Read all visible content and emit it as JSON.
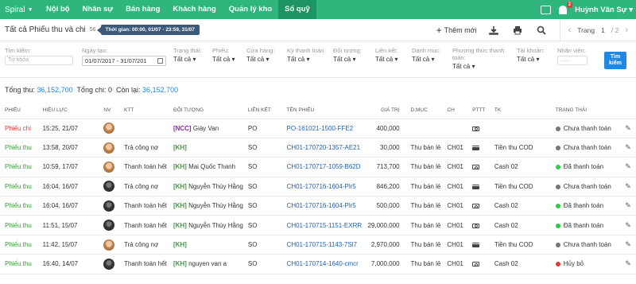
{
  "nav": {
    "brand": "Spiral",
    "items": [
      "Nội bộ",
      "Nhân sự",
      "Bán hàng",
      "Khách hàng",
      "Quản lý kho",
      "Sổ quỹ"
    ],
    "user": "Huỳnh Văn Sự",
    "notification_count": "2"
  },
  "header": {
    "title": "Tất cả Phiếu thu và chi",
    "count": "56",
    "time_chip": "Thời gian: 00:00, 01/07 - 23:59, 31/07",
    "add_label": "Thêm mới",
    "page_label": "Trang",
    "page_current": "1",
    "page_total": "/ 2"
  },
  "filters": {
    "search_label": "Tìm kiếm:",
    "search_placeholder": "Từ khóa",
    "date_label": "Ngày tạo:",
    "date_value": "01/07/2017 - 31/07/201",
    "status_label": "Trạng thái:",
    "status_value": "Tất cả",
    "type_label": "Phiếu:",
    "type_value": "Tất cả",
    "store_label": "Cửa hàng:",
    "store_value": "Tất cả",
    "period_label": "Kỳ thanh toán:",
    "period_value": "Tất cả",
    "object_label": "Đối tượng:",
    "object_value": "Tất cả",
    "link_label": "Liên kết:",
    "link_value": "Tất cả",
    "category_label": "Danh mục:",
    "category_value": "Tất cả",
    "method_label": "Phương thức thanh toán:",
    "method_value": "Tất cả",
    "account_label": "Tài khoản:",
    "account_value": "Tất cả",
    "staff_label": "Nhân viên:",
    "staff_value": "......",
    "search_button": "Tìm kiếm"
  },
  "totals": {
    "income_label": "Tổng thu:",
    "income": "36,152,700",
    "expense_label": "Tổng chi:",
    "expense": "0",
    "remain_label": "Còn lại:",
    "remain": "36,152,700"
  },
  "columns": [
    "PHIẾU",
    "HIỆU LỰC",
    "NV",
    "KTT",
    "ĐỐI TƯỢNG",
    "LIÊN KẾT",
    "TÊN PHIẾU",
    "GIÁ TRỊ",
    "D.MỤC",
    "CH",
    "PTTT",
    "TK",
    "TRẠNG THÁI"
  ],
  "rows": [
    {
      "type": "Phiếu chi",
      "kind": "chi",
      "date": "15:25, 21/07",
      "avatar": "a",
      "ktt": "",
      "tag": "[NCC]",
      "tagkind": "ncc",
      "obj": "Giày Van",
      "link": "PO",
      "name": "PO-161021-1500-FFE2",
      "value": "400,000",
      "cat": "",
      "ch": "",
      "pttt": "cash",
      "tk": "",
      "status": "Chưa thanh toán",
      "status_color": "#757575"
    },
    {
      "type": "Phiếu thu",
      "kind": "thu",
      "date": "13:58, 20/07",
      "avatar": "a",
      "ktt": "Trả công nợ",
      "tag": "[KH]",
      "tagkind": "kh",
      "obj": "",
      "link": "SO",
      "name": "CH01-170720-1357-AE21",
      "value": "30,000",
      "cat": "Thu bán lẻ",
      "ch": "CH01",
      "pttt": "card",
      "tk": "Tiền thu COD",
      "status": "Chưa thanh toán",
      "status_color": "#757575"
    },
    {
      "type": "Phiếu thu",
      "kind": "thu",
      "date": "10:59, 17/07",
      "avatar": "a",
      "ktt": "Thanh toán hết",
      "tag": "[KH]",
      "tagkind": "kh",
      "obj": "Mai Quốc Thanh",
      "link": "SO",
      "name": "CH01-170717-1059-B62D",
      "value": "713,700",
      "cat": "Thu bán lẻ",
      "ch": "CH01",
      "pttt": "cash",
      "tk": "Cash 02",
      "status": "Đã thanh toán",
      "status_color": "#2ecc40"
    },
    {
      "type": "Phiếu thu",
      "kind": "thu",
      "date": "16:04, 16/07",
      "avatar": "b",
      "ktt": "Trả công nợ",
      "tag": "[KH]",
      "tagkind": "kh",
      "obj": "Nguyễn Thùy Hằng",
      "link": "SO",
      "name": "CH01-170716-1604-Plr5",
      "value": "846,200",
      "cat": "Thu bán lẻ",
      "ch": "CH01",
      "pttt": "card",
      "tk": "Tiền thu COD",
      "status": "Chưa thanh toán",
      "status_color": "#757575"
    },
    {
      "type": "Phiếu thu",
      "kind": "thu",
      "date": "16:04, 16/07",
      "avatar": "b",
      "ktt": "Thanh toán hết",
      "tag": "[KH]",
      "tagkind": "kh",
      "obj": "Nguyễn Thùy Hằng",
      "link": "SO",
      "name": "CH01-170716-1604-Plr5",
      "value": "500,000",
      "cat": "Thu bán lẻ",
      "ch": "CH01",
      "pttt": "cash",
      "tk": "Cash 02",
      "status": "Đã thanh toán",
      "status_color": "#2ecc40"
    },
    {
      "type": "Phiếu thu",
      "kind": "thu",
      "date": "11:51, 15/07",
      "avatar": "b",
      "ktt": "Thanh toán hết",
      "tag": "[KH]",
      "tagkind": "kh",
      "obj": "Nguyễn Thùy Hằng",
      "link": "SO",
      "name": "CH01-170715-1151-EXRR",
      "value": "29,000,000",
      "cat": "Thu bán lẻ",
      "ch": "CH01",
      "pttt": "cash",
      "tk": "Cash 02",
      "status": "Đã thanh toán",
      "status_color": "#2ecc40"
    },
    {
      "type": "Phiếu thu",
      "kind": "thu",
      "date": "11:42, 15/07",
      "avatar": "a",
      "ktt": "Trả công nợ",
      "tag": "[KH]",
      "tagkind": "kh",
      "obj": "",
      "link": "SO",
      "name": "CH01-170715-1143-7Sl7",
      "value": "2,970,000",
      "cat": "Thu bán lẻ",
      "ch": "CH01",
      "pttt": "card",
      "tk": "Tiền thu COD",
      "status": "Chưa thanh toán",
      "status_color": "#757575"
    },
    {
      "type": "Phiếu thu",
      "kind": "thu",
      "date": "16:40, 14/07",
      "avatar": "b",
      "ktt": "Thanh toán hết",
      "tag": "[KH]",
      "tagkind": "kh",
      "obj": "nguyen van a",
      "link": "SO",
      "name": "CH01-170714-1640-cmcr",
      "value": "7,000,000",
      "cat": "Thu bán lẻ",
      "ch": "CH01",
      "pttt": "cash",
      "tk": "Cash 02",
      "status": "Hủy bỏ",
      "status_color": "#e53935"
    }
  ]
}
